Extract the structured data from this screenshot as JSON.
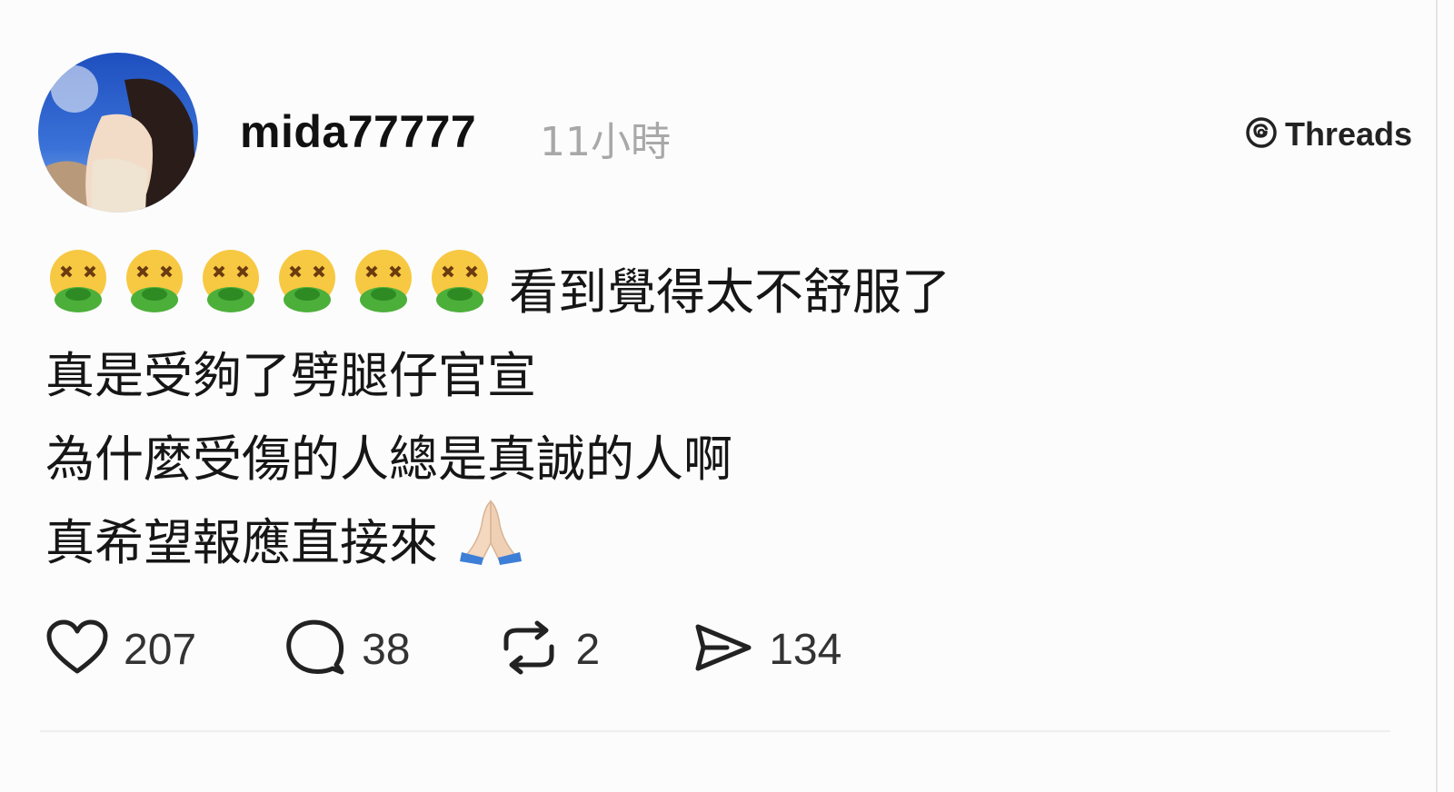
{
  "post": {
    "username": "mida77777",
    "timestamp": "11小時",
    "brand": "Threads",
    "lines": [
      {
        "text": "看到覺得太不舒服了",
        "emojis": [
          "nauseated-face-icon",
          "nauseated-face-icon",
          "nauseated-face-icon",
          "nauseated-face-icon",
          "nauseated-face-icon",
          "nauseated-face-icon"
        ]
      },
      {
        "text": "真是受夠了劈腿仔官宣"
      },
      {
        "text": "為什麼受傷的人總是真誠的人啊"
      },
      {
        "text": "真希望報應直接來",
        "emoji_after": "folded-hands-icon"
      }
    ],
    "actions": {
      "likes": "207",
      "comments": "38",
      "reposts": "2",
      "shares": "134"
    }
  },
  "colors": {
    "text": "#161616",
    "muted": "#a8a8a8",
    "nausea_face": "#f7c842",
    "nausea_green": "#4caf3a"
  }
}
